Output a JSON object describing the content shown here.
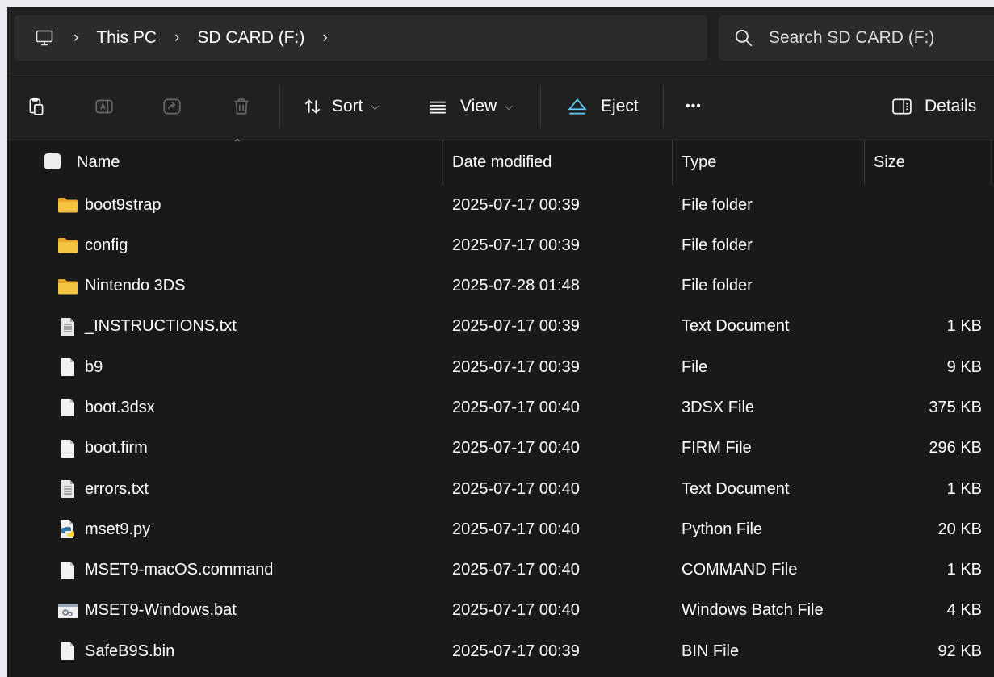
{
  "address": {
    "crumbs": [
      "This PC",
      "SD CARD (F:)"
    ],
    "search_placeholder": "Search SD CARD (F:)"
  },
  "toolbar": {
    "sort_label": "Sort",
    "view_label": "View",
    "eject_label": "Eject",
    "more_label": "•••",
    "details_label": "Details"
  },
  "columns": {
    "name": "Name",
    "date": "Date modified",
    "type": "Type",
    "size": "Size"
  },
  "files": [
    {
      "name": "boot9strap",
      "date": "2025-07-17 00:39",
      "type": "File folder",
      "size": "",
      "icon": "folder-icon"
    },
    {
      "name": "config",
      "date": "2025-07-17 00:39",
      "type": "File folder",
      "size": "",
      "icon": "folder-icon"
    },
    {
      "name": "Nintendo 3DS",
      "date": "2025-07-28 01:48",
      "type": "File folder",
      "size": "",
      "icon": "folder-icon"
    },
    {
      "name": "_INSTRUCTIONS.txt",
      "date": "2025-07-17 00:39",
      "type": "Text Document",
      "size": "1 KB",
      "icon": "text-file-icon"
    },
    {
      "name": "b9",
      "date": "2025-07-17 00:39",
      "type": "File",
      "size": "9 KB",
      "icon": "file-icon"
    },
    {
      "name": "boot.3dsx",
      "date": "2025-07-17 00:40",
      "type": "3DSX File",
      "size": "375 KB",
      "icon": "file-icon"
    },
    {
      "name": "boot.firm",
      "date": "2025-07-17 00:40",
      "type": "FIRM File",
      "size": "296 KB",
      "icon": "file-icon"
    },
    {
      "name": "errors.txt",
      "date": "2025-07-17 00:40",
      "type": "Text Document",
      "size": "1 KB",
      "icon": "text-file-icon"
    },
    {
      "name": "mset9.py",
      "date": "2025-07-17 00:40",
      "type": "Python File",
      "size": "20 KB",
      "icon": "python-file-icon"
    },
    {
      "name": "MSET9-macOS.command",
      "date": "2025-07-17 00:40",
      "type": "COMMAND File",
      "size": "1 KB",
      "icon": "file-icon"
    },
    {
      "name": "MSET9-Windows.bat",
      "date": "2025-07-17 00:40",
      "type": "Windows Batch File",
      "size": "4 KB",
      "icon": "batch-file-icon"
    },
    {
      "name": "SafeB9S.bin",
      "date": "2025-07-17 00:39",
      "type": "BIN File",
      "size": "92 KB",
      "icon": "file-icon"
    }
  ],
  "colors": {
    "folder": "#f5c542",
    "accent": "#60cdff",
    "background": "#191919"
  }
}
